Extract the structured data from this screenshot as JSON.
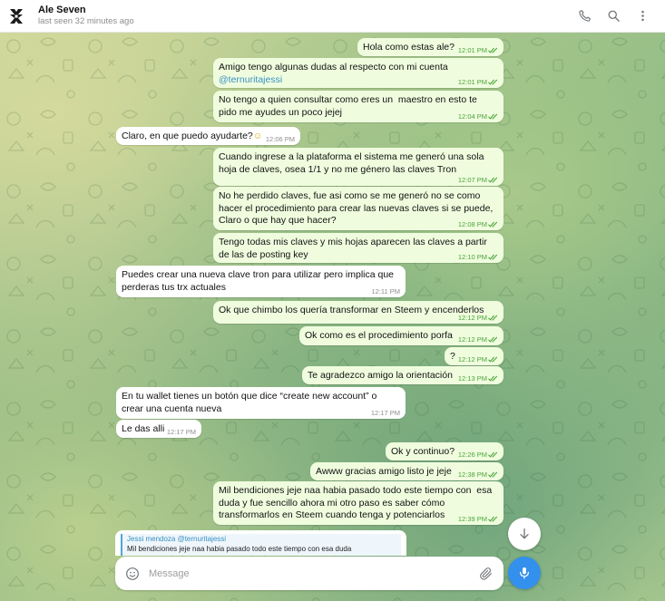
{
  "header": {
    "name": "Ale Seven",
    "status": "last seen 32 minutes ago",
    "avatar_icon": "team-logo-icon",
    "actions": [
      "phone-icon",
      "search-icon",
      "more-vertical-icon"
    ]
  },
  "colors": {
    "outgoing_bubble": "#effdde",
    "incoming_bubble": "#ffffff",
    "checkmark": "#4da33b",
    "accent": "#3390ec",
    "mention": "#3a8fc4"
  },
  "messages": [
    {
      "dir": "out",
      "text": "Hola como estas ale?",
      "time": "12:01 PM",
      "read": true
    },
    {
      "dir": "out",
      "text": "Amigo tengo algunas dudas al respecto con mi cuenta",
      "mention": "@ternuritajessi",
      "time": "12:01 PM",
      "read": true
    },
    {
      "dir": "out",
      "text": "No tengo a quien consultar como eres un  maestro en esto te\npido me ayudes un poco jejej",
      "time": "12:04 PM",
      "read": true
    },
    {
      "dir": "in",
      "text": "Claro, en que puedo ayudarte?",
      "emoji": "☺",
      "time": "12:06 PM"
    },
    {
      "dir": "out",
      "text": "Cuando ingrese a la plataforma el sistema me generó una sola\nhoja de claves, osea 1/1 y no me génerο las claves Tron",
      "time": "12:07 PM",
      "read": true
    },
    {
      "dir": "out",
      "text": "No he perdido claves, fue asi como se me generó no se como\nhacer el procedimiento para crear las nuevas claves si se puede,\nClaro o que hay que hacer?",
      "time": "12:08 PM",
      "read": true
    },
    {
      "dir": "out",
      "text": "Tengo todas mis claves y mis hojas aparecen las claves a partir\nde las de posting key",
      "time": "12:10 PM",
      "read": true
    },
    {
      "dir": "in",
      "text": "Puedes crear una nueva clave tron para utilizar pero implica que\nperderas tus trx actuales",
      "time": "12:11 PM"
    },
    {
      "dir": "out",
      "text": "Ok que chimbo los quería transformar en Steem y encenderlos",
      "time": "12:12 PM",
      "read": true
    },
    {
      "dir": "out",
      "text": "Ok como es el procedimiento porfa",
      "time": "12:12 PM",
      "read": true
    },
    {
      "dir": "out",
      "text": "?",
      "time": "12:12 PM",
      "read": true
    },
    {
      "dir": "out",
      "text": "Te agradezco amigo la orientación",
      "time": "12:13 PM",
      "read": true
    },
    {
      "dir": "in",
      "text": "En tu wallet tienes un botón que dice “create new account” o\ncrear una cuenta nueva",
      "time": "12:17 PM"
    },
    {
      "dir": "in",
      "text": "Le das alli",
      "time": "12:17 PM"
    },
    {
      "dir": "out",
      "text": "Ok y continuo?",
      "time": "12:26 PM",
      "read": true
    },
    {
      "dir": "out",
      "text": "Awww gracias amigo listo je jeje",
      "time": "12:38 PM",
      "read": true
    },
    {
      "dir": "out",
      "text": "Mil bendiciones jeje naa habia pasado todo este tiempo con  esa\nduda y fue sencillo ahora mi otro paso es saber cómo\ntransformarlos en Steem cuando tenga y potenciarlos",
      "time": "12:39 PM",
      "read": true
    }
  ],
  "reply_preview": {
    "author": "Jessi mendoza @ternuritajessi",
    "text": "Mil bendiciones jeje naa habia pasado todo este tiempo con esa duda"
  },
  "composer": {
    "placeholder": "Message",
    "emoji_icon": "smile-icon",
    "attach_icon": "paperclip-icon",
    "send_icon": "microphone-icon",
    "scroll_icon": "arrow-down-icon"
  }
}
